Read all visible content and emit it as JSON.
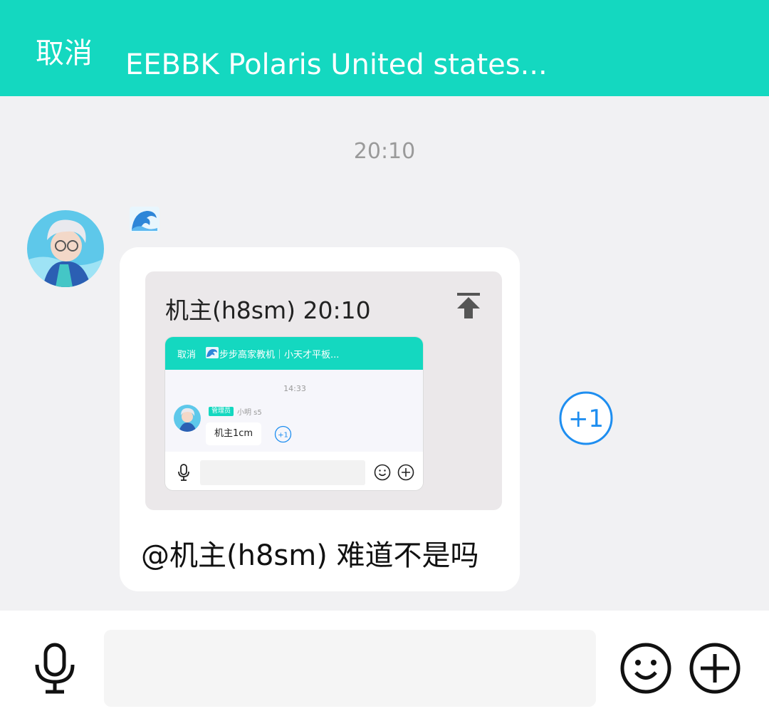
{
  "header": {
    "cancel_label": "取消",
    "title": "EEBBK Polaris United states..."
  },
  "chat": {
    "timestamp": "20:10",
    "message": {
      "quote": {
        "meta": "机主(h8sm) 20:10",
        "screenshot": {
          "cancel_label": "取消",
          "title": "步步高家教机｜小天才平板...",
          "timestamp": "14:33",
          "badge": "管理员",
          "sender": "小明 s5",
          "message": "机主1cm",
          "plus_label": "+1"
        }
      },
      "text": "@机主(h8sm) 难道不是吗"
    },
    "plus_one_label": "+1"
  },
  "colors": {
    "accent": "#14d8c0",
    "background": "#f1f1f3",
    "link_blue": "#1e8ef0"
  }
}
